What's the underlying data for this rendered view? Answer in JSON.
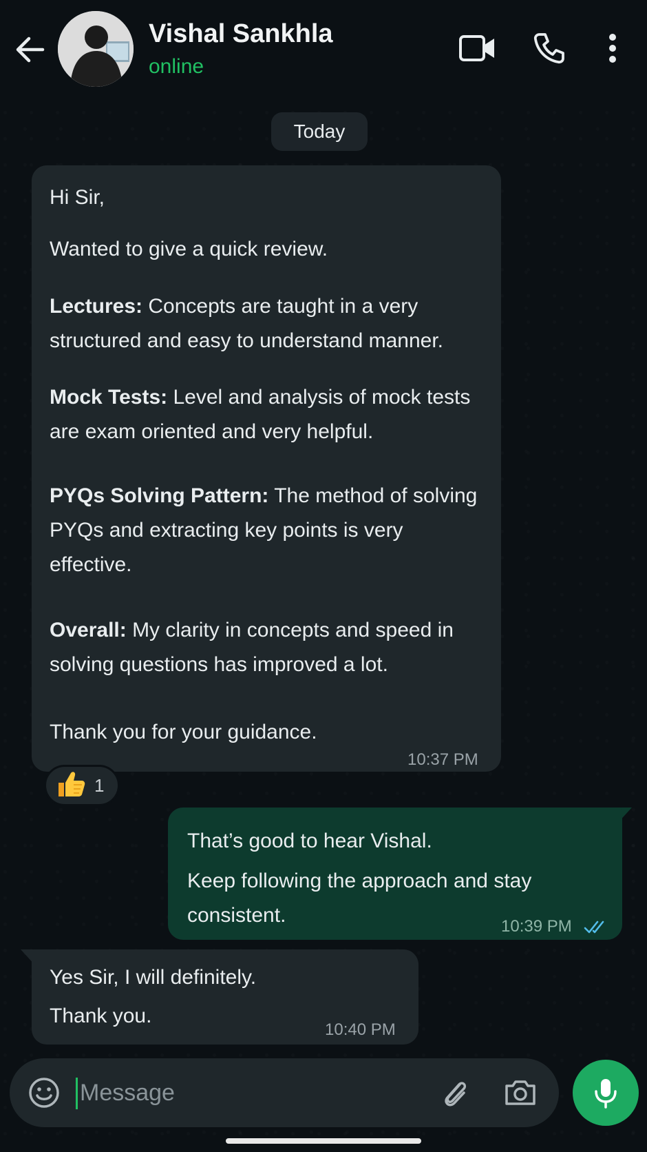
{
  "header": {
    "contact_name": "Vishal Sankhla",
    "status": "online",
    "icons": [
      "back-arrow-icon",
      "video-call-icon",
      "phone-call-icon",
      "more-vert-icon"
    ]
  },
  "date_chip": "Today",
  "messages": [
    {
      "direction": "incoming",
      "greeting": "Hi Sir,",
      "intro": "Wanted to give a quick review.",
      "sections": [
        {
          "heading": "Lectures:",
          "text": " Concepts are taught in a very structured and easy to understand manner."
        },
        {
          "heading": "Mock Tests:",
          "text": " Level and analysis of mock tests are exam oriented and very helpful."
        },
        {
          "heading": "PYQs Solving Pattern:",
          "text": " The method of solving PYQs and extracting key points is very effective."
        },
        {
          "heading": "Overall:",
          "text": " My clarity in concepts and speed in solving questions has improved a lot."
        }
      ],
      "closing": "Thank you for your guidance.",
      "time": "10:37 PM",
      "reaction": {
        "emoji": "👍",
        "count": "1"
      }
    },
    {
      "direction": "outgoing",
      "line1": "That’s good to hear Vishal.",
      "line2": "Keep following the approach and stay consistent.",
      "time": "10:39 PM",
      "read_receipt": "double-check-icon"
    },
    {
      "direction": "incoming",
      "line1": "Yes Sir, I will definitely.",
      "line2": "Thank you.",
      "time": "10:40 PM"
    }
  ],
  "composer": {
    "placeholder": "Message",
    "icons": [
      "emoji-icon",
      "attach-icon",
      "camera-icon",
      "mic-icon"
    ]
  },
  "colors": {
    "accent_green": "#21c063",
    "outgoing_bubble": "#0d3b2e",
    "incoming_bubble": "#1f272b",
    "read_tick": "#53bdeb",
    "mic_button": "#1daa61"
  }
}
